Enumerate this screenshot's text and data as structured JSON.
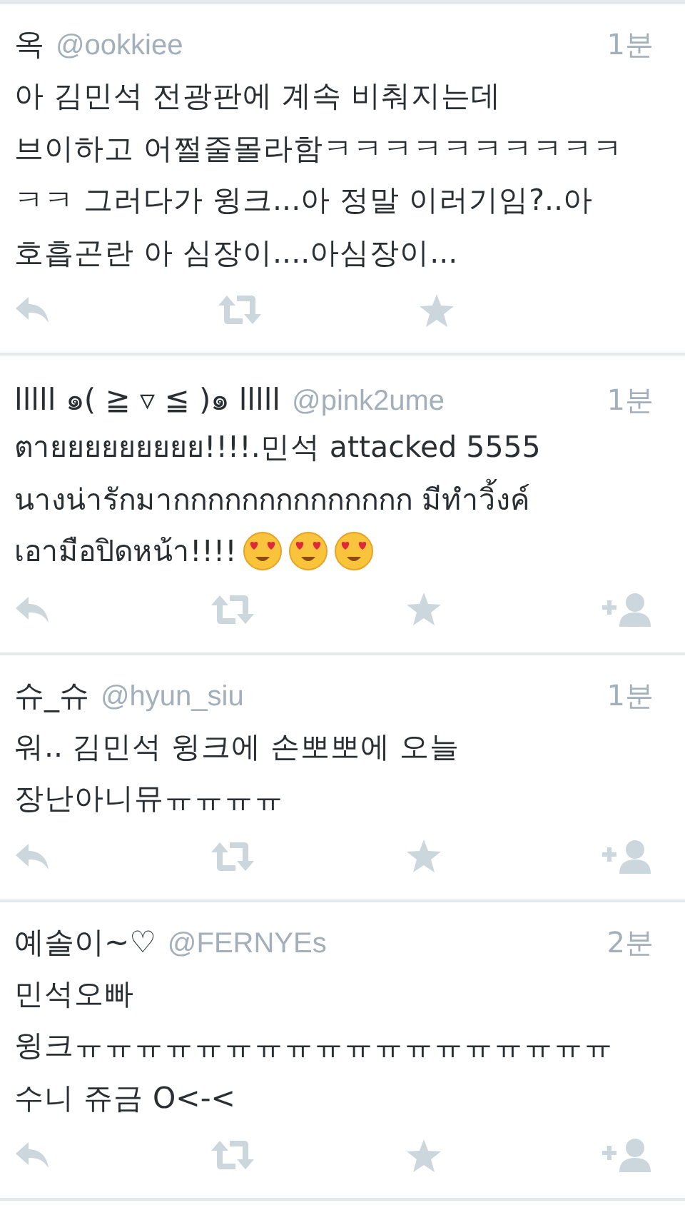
{
  "tweets": [
    {
      "name": "옥",
      "handle": "@ookkiee",
      "time": "1분",
      "lines": [
        "아 김민석 전광판에 계속 비춰지는데",
        "브이하고 어쩔줄몰라함ㅋㅋㅋㅋㅋㅋㅋㅋㅋㅋ",
        "ㅋㅋ 그러다가 윙크...아 정말 이러기임?..아",
        "호흡곤란 아 심장이....아심장이..."
      ],
      "follow_button": false
    },
    {
      "name": "lllll ๑( ≧ ▿ ≦ )๑ lllll",
      "handle": "@pink2ume",
      "time": "1분",
      "lines": [
        "ตายยยยยยยยย!!!!.민석 attacked 5555",
        "นางน่ารักมากกกกกกกกกกกกกก มีทำวิ้งค์",
        "เอามือปิดหน้า!!!!"
      ],
      "emojis": [
        {
          "kind": "heart-eyes"
        },
        {
          "kind": "heart-eyes"
        },
        {
          "kind": "heart-eyes"
        }
      ],
      "follow_button": true
    },
    {
      "name": "슈_슈",
      "handle": "@hyun_siu",
      "time": "1분",
      "lines": [
        "워.. 김민석 윙크에 손뽀뽀에 오늘",
        "장난아니뮤ㅠㅠㅠㅠ"
      ],
      "follow_button": true
    },
    {
      "name": "예솔이~♡",
      "handle": "@FERNYEs",
      "time": "2분",
      "lines": [
        "민석오빠",
        "윙크ㅠㅠㅠㅠㅠㅠㅠㅠㅠㅠㅠㅠㅠㅠㅠㅠㅠㅠ",
        "수니 쥬금 O<-<"
      ],
      "follow_button": true
    }
  ]
}
